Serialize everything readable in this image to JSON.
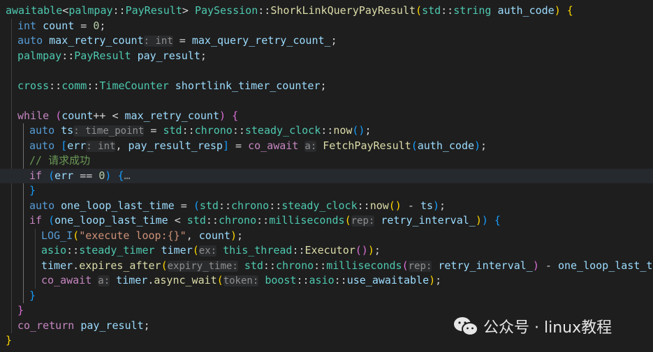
{
  "editor": {
    "lines": [
      {
        "indent": 0,
        "current": false,
        "segments": [
          {
            "t": "awaitable",
            "c": "type"
          },
          {
            "t": "<",
            "c": "op"
          },
          {
            "t": "palmpay",
            "c": "type"
          },
          {
            "t": "::",
            "c": "op"
          },
          {
            "t": "PayResult",
            "c": "type"
          },
          {
            "t": "> ",
            "c": "op"
          },
          {
            "t": "PaySession",
            "c": "type"
          },
          {
            "t": "::",
            "c": "op"
          },
          {
            "t": "ShorkLinkQueryPayResult",
            "c": "fn"
          },
          {
            "t": "(",
            "c": "b1"
          },
          {
            "t": "std",
            "c": "type"
          },
          {
            "t": "::",
            "c": "op"
          },
          {
            "t": "string",
            "c": "type"
          },
          {
            "t": " ",
            "c": "op"
          },
          {
            "t": "auth_code",
            "c": "var"
          },
          {
            "t": ")",
            "c": "b1"
          },
          {
            "t": " ",
            "c": "op"
          },
          {
            "t": "{",
            "c": "b1"
          }
        ]
      },
      {
        "indent": 1,
        "current": false,
        "segments": [
          {
            "t": "int",
            "c": "kw"
          },
          {
            "t": " ",
            "c": "op"
          },
          {
            "t": "count",
            "c": "var"
          },
          {
            "t": " = ",
            "c": "op"
          },
          {
            "t": "0",
            "c": "num"
          },
          {
            "t": ";",
            "c": "op"
          }
        ]
      },
      {
        "indent": 1,
        "current": false,
        "segments": [
          {
            "t": "auto",
            "c": "kw"
          },
          {
            "t": " ",
            "c": "op"
          },
          {
            "t": "max_retry_count",
            "c": "var"
          },
          {
            "t": ": int",
            "c": "hint"
          },
          {
            "t": " = ",
            "c": "op"
          },
          {
            "t": "max_query_retry_count_",
            "c": "var"
          },
          {
            "t": ";",
            "c": "op"
          }
        ]
      },
      {
        "indent": 1,
        "current": false,
        "segments": [
          {
            "t": "palmpay",
            "c": "type"
          },
          {
            "t": "::",
            "c": "op"
          },
          {
            "t": "PayResult",
            "c": "type"
          },
          {
            "t": " ",
            "c": "op"
          },
          {
            "t": "pay_result",
            "c": "var"
          },
          {
            "t": ";",
            "c": "op"
          }
        ]
      },
      {
        "indent": 1,
        "current": false,
        "segments": []
      },
      {
        "indent": 1,
        "current": false,
        "segments": [
          {
            "t": "cross",
            "c": "type"
          },
          {
            "t": "::",
            "c": "op"
          },
          {
            "t": "comm",
            "c": "type"
          },
          {
            "t": "::",
            "c": "op"
          },
          {
            "t": "TimeCounter",
            "c": "type"
          },
          {
            "t": " ",
            "c": "op"
          },
          {
            "t": "shortlink_timer_counter",
            "c": "var"
          },
          {
            "t": ";",
            "c": "op"
          }
        ]
      },
      {
        "indent": 1,
        "current": false,
        "segments": []
      },
      {
        "indent": 1,
        "current": false,
        "segments": [
          {
            "t": "while",
            "c": "ctrl"
          },
          {
            "t": " ",
            "c": "op"
          },
          {
            "t": "(",
            "c": "b2"
          },
          {
            "t": "count",
            "c": "var"
          },
          {
            "t": "++ < ",
            "c": "op"
          },
          {
            "t": "max_retry_count",
            "c": "var"
          },
          {
            "t": ")",
            "c": "b2"
          },
          {
            "t": " ",
            "c": "op"
          },
          {
            "t": "{",
            "c": "b2"
          }
        ]
      },
      {
        "indent": 2,
        "current": false,
        "segments": [
          {
            "t": "auto",
            "c": "kw"
          },
          {
            "t": " ",
            "c": "op"
          },
          {
            "t": "ts",
            "c": "var"
          },
          {
            "t": ": time_point",
            "c": "hint"
          },
          {
            "t": " = ",
            "c": "op"
          },
          {
            "t": "std",
            "c": "type"
          },
          {
            "t": "::",
            "c": "op"
          },
          {
            "t": "chrono",
            "c": "type"
          },
          {
            "t": "::",
            "c": "op"
          },
          {
            "t": "steady_clock",
            "c": "type"
          },
          {
            "t": "::",
            "c": "op"
          },
          {
            "t": "now",
            "c": "fn"
          },
          {
            "t": "()",
            "c": "b3"
          },
          {
            "t": ";",
            "c": "op"
          }
        ]
      },
      {
        "indent": 2,
        "current": false,
        "segments": [
          {
            "t": "auto",
            "c": "kw"
          },
          {
            "t": " ",
            "c": "op"
          },
          {
            "t": "[",
            "c": "b3"
          },
          {
            "t": "err",
            "c": "var"
          },
          {
            "t": ": int",
            "c": "hint"
          },
          {
            "t": ", ",
            "c": "op"
          },
          {
            "t": "pay_result_resp",
            "c": "var"
          },
          {
            "t": "]",
            "c": "b3"
          },
          {
            "t": " = ",
            "c": "op"
          },
          {
            "t": "co_await",
            "c": "ctrl"
          },
          {
            "t": " ",
            "c": "op"
          },
          {
            "t": "a:",
            "c": "hint"
          },
          {
            "t": " ",
            "c": "op"
          },
          {
            "t": "FetchPayResult",
            "c": "fn"
          },
          {
            "t": "(",
            "c": "b3"
          },
          {
            "t": "auth_code",
            "c": "var"
          },
          {
            "t": ")",
            "c": "b3"
          },
          {
            "t": ";",
            "c": "op"
          }
        ]
      },
      {
        "indent": 2,
        "current": false,
        "segments": [
          {
            "t": "// 请求成功",
            "c": "cm"
          }
        ]
      },
      {
        "indent": 2,
        "current": true,
        "segments": [
          {
            "t": "if",
            "c": "ctrl"
          },
          {
            "t": " ",
            "c": "op"
          },
          {
            "t": "(",
            "c": "b3"
          },
          {
            "t": "err",
            "c": "var"
          },
          {
            "t": " == ",
            "c": "op"
          },
          {
            "t": "0",
            "c": "num"
          },
          {
            "t": ")",
            "c": "b3"
          },
          {
            "t": " ",
            "c": "op"
          },
          {
            "t": "{",
            "c": "b3"
          },
          {
            "t": "…",
            "c": "fold"
          }
        ]
      },
      {
        "indent": 2,
        "current": false,
        "segments": [
          {
            "t": "}",
            "c": "b3"
          }
        ]
      },
      {
        "indent": 2,
        "current": false,
        "segments": [
          {
            "t": "auto",
            "c": "kw"
          },
          {
            "t": " ",
            "c": "op"
          },
          {
            "t": "one_loop_last_time",
            "c": "var"
          },
          {
            "t": " = ",
            "c": "op"
          },
          {
            "t": "(",
            "c": "b3"
          },
          {
            "t": "std",
            "c": "type"
          },
          {
            "t": "::",
            "c": "op"
          },
          {
            "t": "chrono",
            "c": "type"
          },
          {
            "t": "::",
            "c": "op"
          },
          {
            "t": "steady_clock",
            "c": "type"
          },
          {
            "t": "::",
            "c": "op"
          },
          {
            "t": "now",
            "c": "fn"
          },
          {
            "t": "()",
            "c": "b1"
          },
          {
            "t": " - ",
            "c": "op"
          },
          {
            "t": "ts",
            "c": "var"
          },
          {
            "t": ")",
            "c": "b3"
          },
          {
            "t": ";",
            "c": "op"
          }
        ]
      },
      {
        "indent": 2,
        "current": false,
        "segments": [
          {
            "t": "if",
            "c": "ctrl"
          },
          {
            "t": " ",
            "c": "op"
          },
          {
            "t": "(",
            "c": "b3"
          },
          {
            "t": "one_loop_last_time",
            "c": "var"
          },
          {
            "t": " < ",
            "c": "op"
          },
          {
            "t": "std",
            "c": "type"
          },
          {
            "t": "::",
            "c": "op"
          },
          {
            "t": "chrono",
            "c": "type"
          },
          {
            "t": "::",
            "c": "op"
          },
          {
            "t": "milliseconds",
            "c": "type"
          },
          {
            "t": "(",
            "c": "b1"
          },
          {
            "t": "rep:",
            "c": "hint"
          },
          {
            "t": " ",
            "c": "op"
          },
          {
            "t": "retry_interval_",
            "c": "var"
          },
          {
            "t": ")",
            "c": "b1"
          },
          {
            "t": ")",
            "c": "b3"
          },
          {
            "t": " ",
            "c": "op"
          },
          {
            "t": "{",
            "c": "b3"
          }
        ]
      },
      {
        "indent": 3,
        "current": false,
        "segments": [
          {
            "t": "LOG_I",
            "c": "kw"
          },
          {
            "t": "(",
            "c": "b1"
          },
          {
            "t": "\"execute loop:{}\"",
            "c": "str"
          },
          {
            "t": ", ",
            "c": "op"
          },
          {
            "t": "count",
            "c": "var"
          },
          {
            "t": ")",
            "c": "b1"
          },
          {
            "t": ";",
            "c": "op"
          }
        ]
      },
      {
        "indent": 3,
        "current": false,
        "segments": [
          {
            "t": "asio",
            "c": "type"
          },
          {
            "t": "::",
            "c": "op"
          },
          {
            "t": "steady_timer",
            "c": "type"
          },
          {
            "t": " ",
            "c": "op"
          },
          {
            "t": "timer",
            "c": "var"
          },
          {
            "t": "(",
            "c": "b1"
          },
          {
            "t": "ex:",
            "c": "hint"
          },
          {
            "t": " ",
            "c": "op"
          },
          {
            "t": "this_thread",
            "c": "type"
          },
          {
            "t": "::",
            "c": "op"
          },
          {
            "t": "Executor",
            "c": "fn"
          },
          {
            "t": "()",
            "c": "b2"
          },
          {
            "t": ")",
            "c": "b1"
          },
          {
            "t": ";",
            "c": "op"
          }
        ]
      },
      {
        "indent": 3,
        "current": false,
        "segments": [
          {
            "t": "timer",
            "c": "var"
          },
          {
            "t": ".",
            "c": "op"
          },
          {
            "t": "expires_after",
            "c": "fn"
          },
          {
            "t": "(",
            "c": "b1"
          },
          {
            "t": "expiry_time:",
            "c": "hint"
          },
          {
            "t": " ",
            "c": "op"
          },
          {
            "t": "std",
            "c": "type"
          },
          {
            "t": "::",
            "c": "op"
          },
          {
            "t": "chrono",
            "c": "type"
          },
          {
            "t": "::",
            "c": "op"
          },
          {
            "t": "milliseconds",
            "c": "type"
          },
          {
            "t": "(",
            "c": "b2"
          },
          {
            "t": "rep:",
            "c": "hint"
          },
          {
            "t": " ",
            "c": "op"
          },
          {
            "t": "retry_interval_",
            "c": "var"
          },
          {
            "t": ")",
            "c": "b2"
          },
          {
            "t": " - ",
            "c": "op"
          },
          {
            "t": "one_loop_last_time",
            "c": "var"
          },
          {
            "t": ")",
            "c": "b1"
          }
        ]
      },
      {
        "indent": 3,
        "current": false,
        "segments": [
          {
            "t": "co_await",
            "c": "ctrl"
          },
          {
            "t": " ",
            "c": "op"
          },
          {
            "t": "a:",
            "c": "hint"
          },
          {
            "t": " ",
            "c": "op"
          },
          {
            "t": "timer",
            "c": "var"
          },
          {
            "t": ".",
            "c": "op"
          },
          {
            "t": "async_wait",
            "c": "fn"
          },
          {
            "t": "(",
            "c": "b1"
          },
          {
            "t": "token:",
            "c": "hint"
          },
          {
            "t": " ",
            "c": "op"
          },
          {
            "t": "boost",
            "c": "type"
          },
          {
            "t": "::",
            "c": "op"
          },
          {
            "t": "asio",
            "c": "type"
          },
          {
            "t": "::",
            "c": "op"
          },
          {
            "t": "use_awaitable",
            "c": "var"
          },
          {
            "t": ")",
            "c": "b1"
          },
          {
            "t": ";",
            "c": "op"
          }
        ]
      },
      {
        "indent": 2,
        "current": false,
        "segments": [
          {
            "t": "}",
            "c": "b3"
          }
        ]
      },
      {
        "indent": 1,
        "current": false,
        "segments": [
          {
            "t": "}",
            "c": "b2"
          }
        ]
      },
      {
        "indent": 1,
        "current": false,
        "segments": [
          {
            "t": "co_return",
            "c": "ctrl"
          },
          {
            "t": " ",
            "c": "op"
          },
          {
            "t": "pay_result",
            "c": "var"
          },
          {
            "t": ";",
            "c": "op"
          }
        ]
      },
      {
        "indent": 0,
        "current": false,
        "segments": [
          {
            "t": "}",
            "c": "b1"
          }
        ]
      }
    ]
  },
  "watermark": {
    "icon": "wechat-icon",
    "text": "公众号 · linux教程"
  }
}
